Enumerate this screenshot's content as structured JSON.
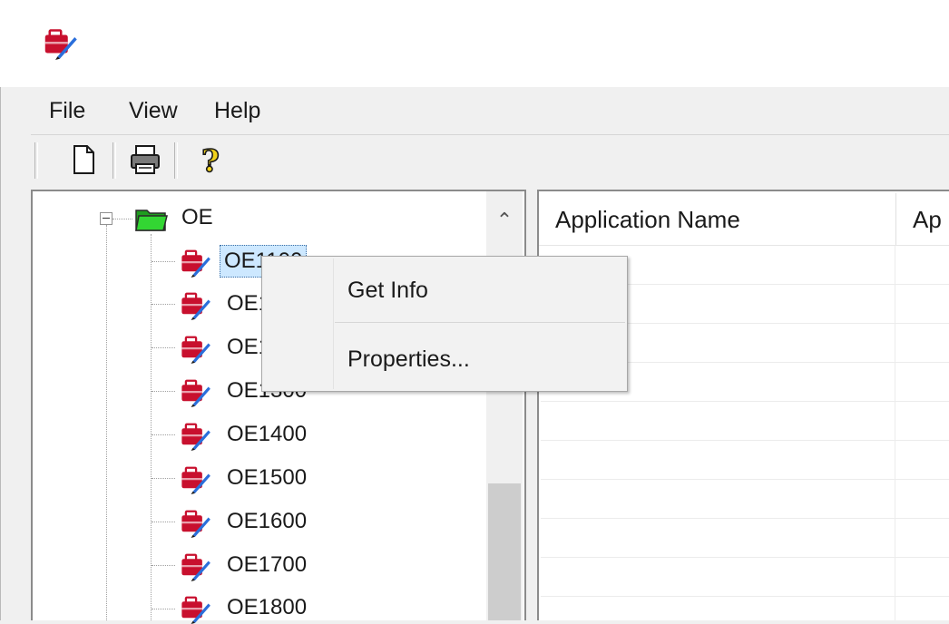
{
  "menu": {
    "items": [
      {
        "label": "File"
      },
      {
        "label": "View"
      },
      {
        "label": "Help"
      }
    ]
  },
  "toolbar": {
    "buttons": [
      {
        "icon": "new-document-icon"
      },
      {
        "icon": "printer-icon"
      },
      {
        "icon": "help-question-icon"
      }
    ]
  },
  "tree": {
    "root": {
      "label": "OE",
      "expanded": true
    },
    "children": [
      {
        "label": "OE1100",
        "selected": true
      },
      {
        "label": "OE1200"
      },
      {
        "label": "OE1300"
      },
      {
        "label": "OE1400"
      },
      {
        "label": "OE1500"
      },
      {
        "label": "OE1600"
      },
      {
        "label": "OE1700"
      },
      {
        "label": "OE1800"
      }
    ]
  },
  "list": {
    "columns": [
      {
        "label": "Application Name"
      },
      {
        "label": "Ap"
      }
    ]
  },
  "context_menu": {
    "items": [
      {
        "label": "Get Info"
      },
      {
        "label": "Properties..."
      }
    ]
  },
  "colors": {
    "selection": "#cde8ff",
    "folder": "#2fbf2f",
    "window_bg": "#f0f0f0",
    "icon_red": "#c8102e"
  }
}
